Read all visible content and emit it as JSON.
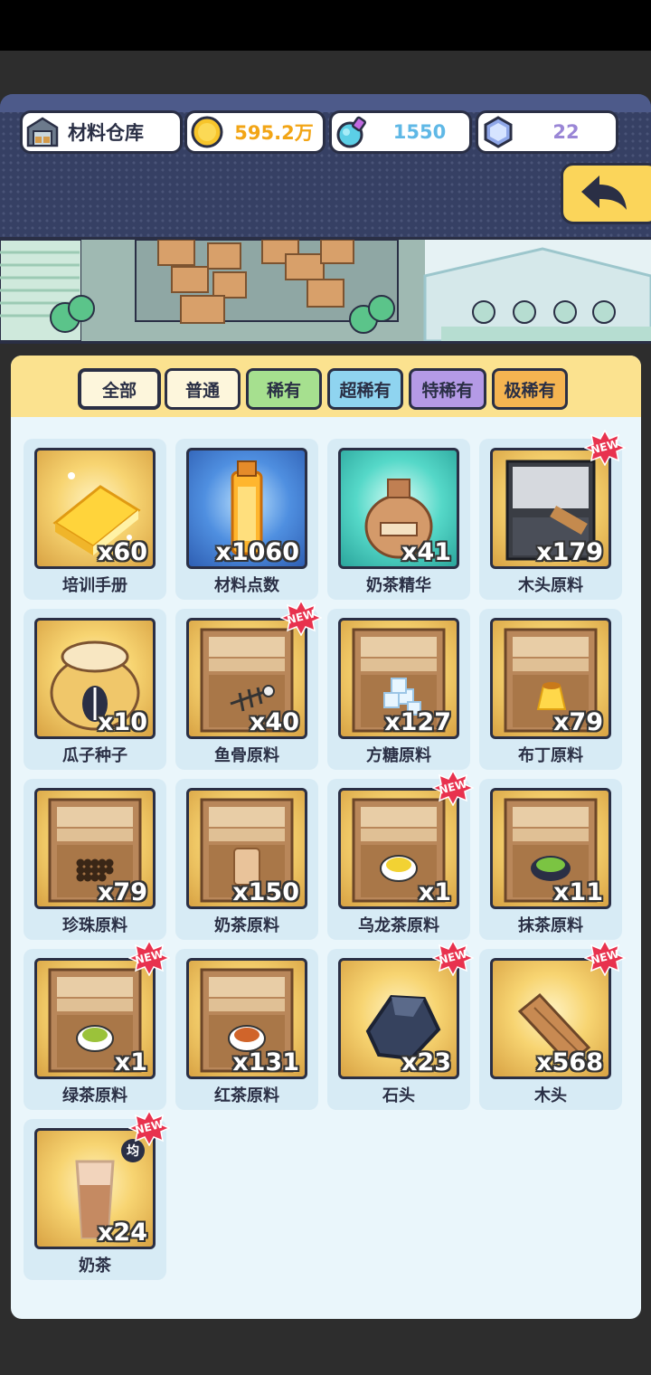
{
  "header": {
    "title": "材料仓库",
    "gold": "595.2万",
    "potion": "1550",
    "gem": "22",
    "colors": {
      "gold_text": "#f2a516",
      "potion_text": "#5fb8e6",
      "gem_text": "#9a86d6"
    }
  },
  "tabs": [
    {
      "label": "全部",
      "color": "#fdf6dc"
    },
    {
      "label": "普通",
      "color": "#fdf6dc"
    },
    {
      "label": "稀有",
      "color": "#a6e08f"
    },
    {
      "label": "超稀有",
      "color": "#8fd4f0"
    },
    {
      "label": "特稀有",
      "color": "#b49ae6"
    },
    {
      "label": "极稀有",
      "color": "#f5b451"
    }
  ],
  "items": [
    {
      "name": "培训手册",
      "count": "x60",
      "icon": "book-icon",
      "bg": "gold",
      "new": false
    },
    {
      "name": "材料点数",
      "count": "x1060",
      "icon": "bottle-icon",
      "bg": "blue",
      "new": false
    },
    {
      "name": "奶茶精华",
      "count": "x41",
      "icon": "jar-icon",
      "bg": "teal",
      "new": false
    },
    {
      "name": "木头原料",
      "count": "x179",
      "icon": "wood-crate-icon",
      "bg": "gold",
      "new": true
    },
    {
      "name": "瓜子种子",
      "count": "x10",
      "icon": "seed-sack-icon",
      "bg": "gold",
      "new": false
    },
    {
      "name": "鱼骨原料",
      "count": "x40",
      "icon": "fishbone-icon",
      "bg": "gold",
      "new": true
    },
    {
      "name": "方糖原料",
      "count": "x127",
      "icon": "sugar-cube-icon",
      "bg": "gold",
      "new": false
    },
    {
      "name": "布丁原料",
      "count": "x79",
      "icon": "pudding-icon",
      "bg": "gold",
      "new": false
    },
    {
      "name": "珍珠原料",
      "count": "x79",
      "icon": "pearl-icon",
      "bg": "gold",
      "new": false
    },
    {
      "name": "奶茶原料",
      "count": "x150",
      "icon": "milk-tea-cup-icon",
      "bg": "gold",
      "new": false
    },
    {
      "name": "乌龙茶原料",
      "count": "x1",
      "icon": "oolong-tea-icon",
      "bg": "gold",
      "new": true
    },
    {
      "name": "抹茶原料",
      "count": "x11",
      "icon": "matcha-icon",
      "bg": "gold",
      "new": false
    },
    {
      "name": "绿茶原料",
      "count": "x1",
      "icon": "green-tea-icon",
      "bg": "gold",
      "new": true
    },
    {
      "name": "红茶原料",
      "count": "x131",
      "icon": "black-tea-icon",
      "bg": "gold",
      "new": false
    },
    {
      "name": "石头",
      "count": "x23",
      "icon": "stone-icon",
      "bg": "gold",
      "new": true
    },
    {
      "name": "木头",
      "count": "x568",
      "icon": "plank-icon",
      "bg": "gold",
      "new": true
    },
    {
      "name": "奶茶",
      "count": "x24",
      "icon": "milk-tea-glass-icon",
      "bg": "gold",
      "new": true,
      "badge": "均"
    }
  ],
  "new_badge_text": "NEW"
}
